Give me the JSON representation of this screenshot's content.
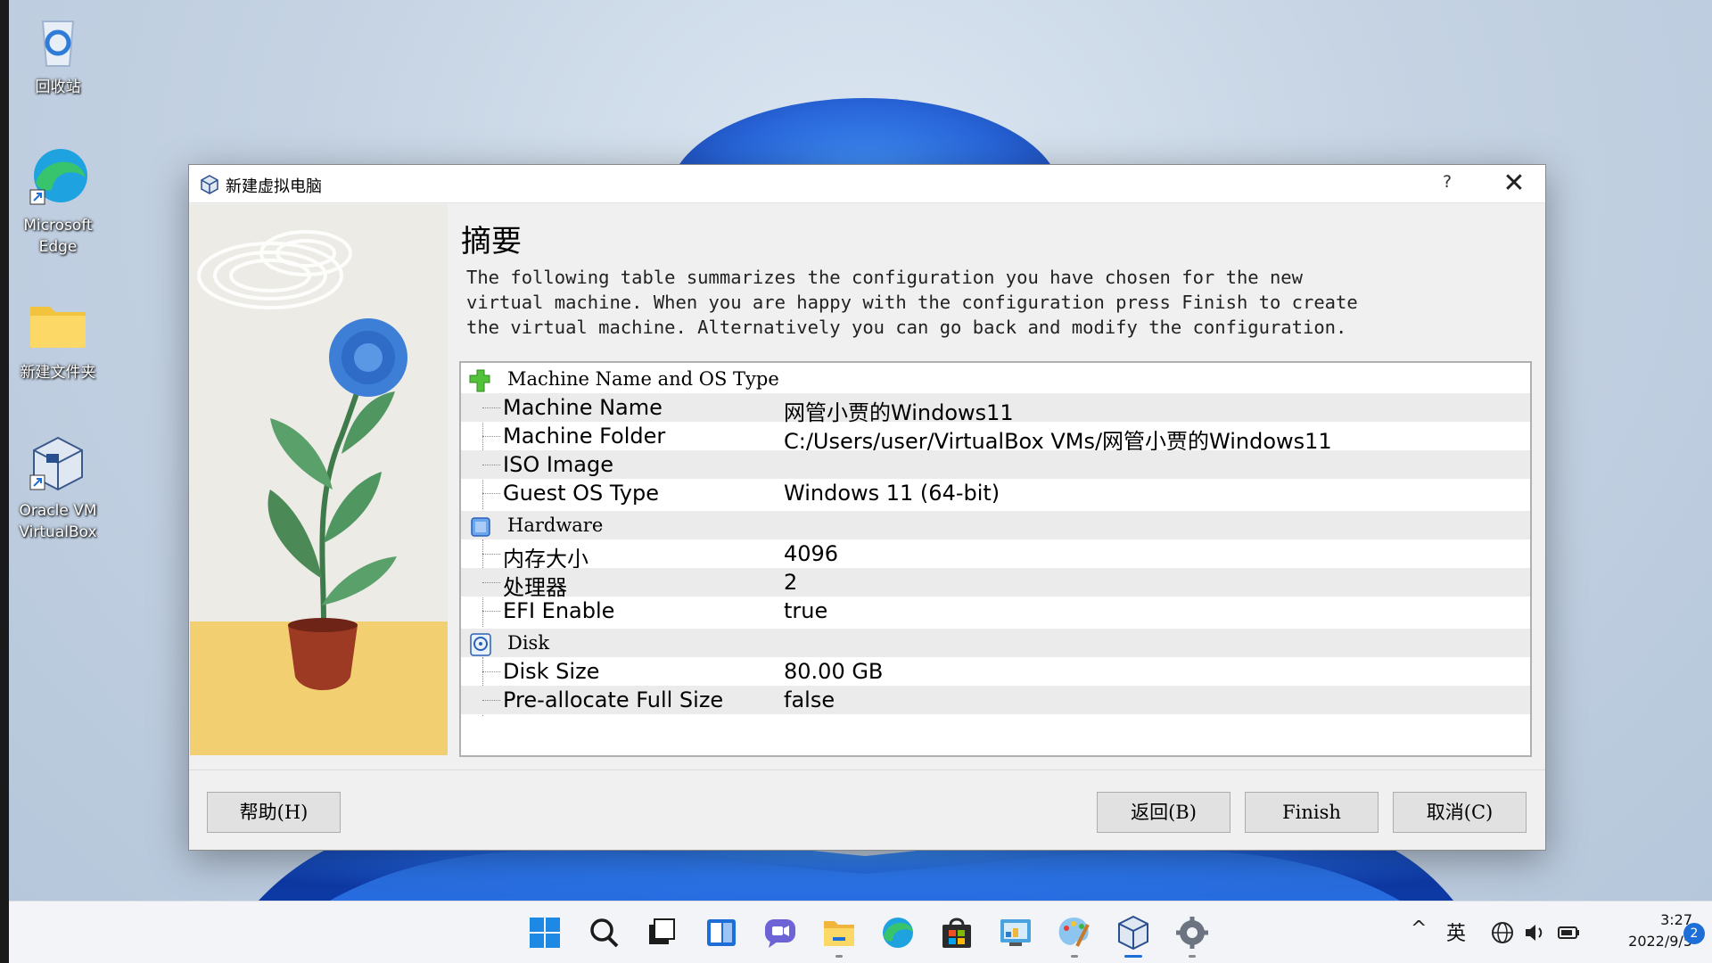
{
  "desktop": {
    "icons": [
      {
        "label_line1": "回收站",
        "label_line2": ""
      },
      {
        "label_line1": "Microsoft",
        "label_line2": "Edge"
      },
      {
        "label_line1": "新建文件夹",
        "label_line2": ""
      },
      {
        "label_line1": "Oracle VM",
        "label_line2": "VirtualBox"
      }
    ]
  },
  "dialog": {
    "title": "新建虚拟电脑",
    "help_glyph": "?",
    "close_glyph": "✕",
    "heading": "摘要",
    "description": "The following table summarizes the configuration you have chosen for the new virtual machine. When you are happy with the configuration press Finish to create the virtual machine. Alternatively you can go back and modify the configuration.",
    "groups": [
      {
        "label": "Machine Name and OS Type",
        "icon": "puzzle-icon",
        "items": [
          {
            "key": "Machine Name",
            "value": "网管小贾的Windows11"
          },
          {
            "key": "Machine Folder",
            "value": "C:/Users/user/VirtualBox VMs/网管小贾的Windows11"
          },
          {
            "key": "ISO Image",
            "value": ""
          },
          {
            "key": "Guest OS Type",
            "value": "Windows 11 (64-bit)"
          }
        ]
      },
      {
        "label": "Hardware",
        "icon": "chip-icon",
        "items": [
          {
            "key": "内存大小",
            "value": "4096"
          },
          {
            "key": "处理器",
            "value": "2"
          },
          {
            "key": "EFI Enable",
            "value": "true"
          }
        ]
      },
      {
        "label": "Disk",
        "icon": "disk-icon",
        "items": [
          {
            "key": "Disk Size",
            "value": "80.00 GB"
          },
          {
            "key": "Pre-allocate Full Size",
            "value": "false"
          }
        ]
      }
    ],
    "buttons": {
      "help": "帮助(H)",
      "back": "返回(B)",
      "finish": "Finish",
      "cancel": "取消(C)"
    }
  },
  "taskbar": {
    "apps": [
      "start-icon",
      "search-icon",
      "task-view-icon",
      "widgets-icon",
      "chat-icon",
      "file-explorer-icon",
      "edge-icon",
      "store-icon",
      "control-panel-icon",
      "paint-icon",
      "virtualbox-icon",
      "settings-icon"
    ],
    "tray": {
      "chevron": "^",
      "ime": "英",
      "time": "3:27",
      "date": "2022/9/5",
      "notifications": "2"
    }
  },
  "colors": {
    "accent": "#1e6ed8",
    "row_alt": "#ebebeb",
    "ground": "#f2cf70"
  }
}
